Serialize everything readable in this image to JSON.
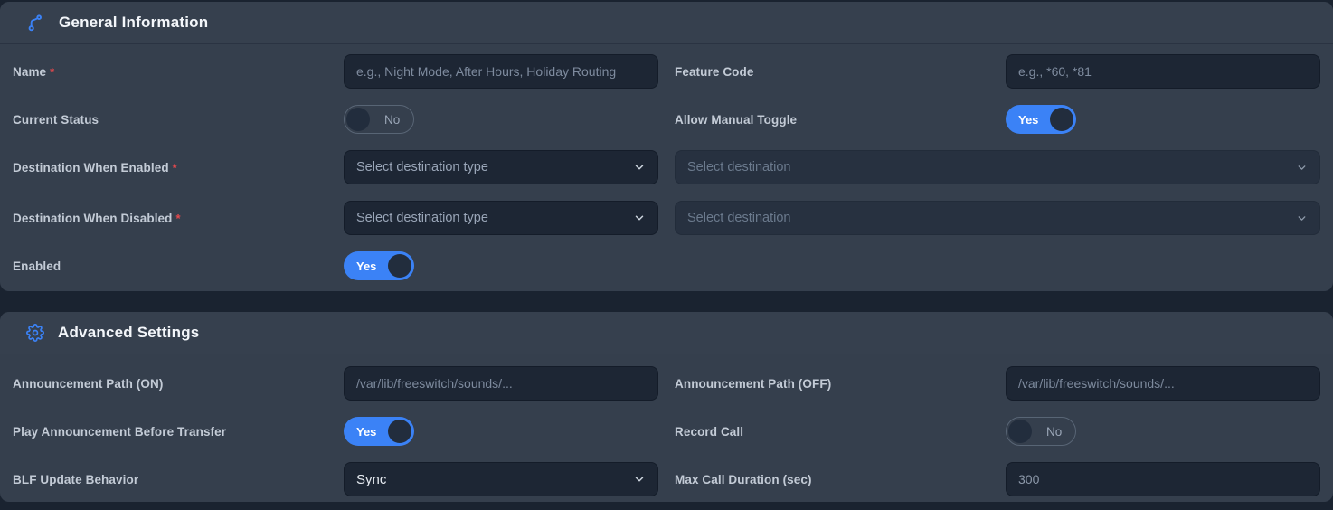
{
  "misc": {
    "required_marker": "*"
  },
  "colors": {
    "accent": "#3b82f6",
    "required": "#e5484d",
    "card": "#353f4d",
    "input_bg": "#1d2634"
  },
  "general": {
    "title": "General Information",
    "icon": "call-split-icon",
    "name": {
      "label": "Name",
      "placeholder": "e.g., Night Mode, After Hours, Holiday Routing"
    },
    "feature_code": {
      "label": "Feature Code",
      "placeholder": "e.g., *60, *81"
    },
    "current_status": {
      "label": "Current Status",
      "value": "No",
      "state": "off"
    },
    "allow_manual_toggle": {
      "label": "Allow Manual Toggle",
      "value": "Yes",
      "state": "on"
    },
    "destination_enabled": {
      "label": "Destination When Enabled",
      "type_placeholder": "Select destination type",
      "destination_placeholder": "Select destination"
    },
    "destination_disabled": {
      "label": "Destination When Disabled",
      "type_placeholder": "Select destination type",
      "destination_placeholder": "Select destination"
    },
    "enabled": {
      "label": "Enabled",
      "value": "Yes",
      "state": "on"
    }
  },
  "advanced": {
    "title": "Advanced Settings",
    "icon": "gear-icon",
    "announcement_on": {
      "label": "Announcement Path (ON)",
      "placeholder": "/var/lib/freeswitch/sounds/..."
    },
    "announcement_off": {
      "label": "Announcement Path (OFF)",
      "placeholder": "/var/lib/freeswitch/sounds/..."
    },
    "play_announcement": {
      "label": "Play Announcement Before Transfer",
      "value": "Yes",
      "state": "on"
    },
    "record_call": {
      "label": "Record Call",
      "value": "No",
      "state": "off"
    },
    "blf": {
      "label": "BLF Update Behavior",
      "value": "Sync"
    },
    "max_call_duration": {
      "label": "Max Call Duration (sec)",
      "value": "300"
    }
  }
}
